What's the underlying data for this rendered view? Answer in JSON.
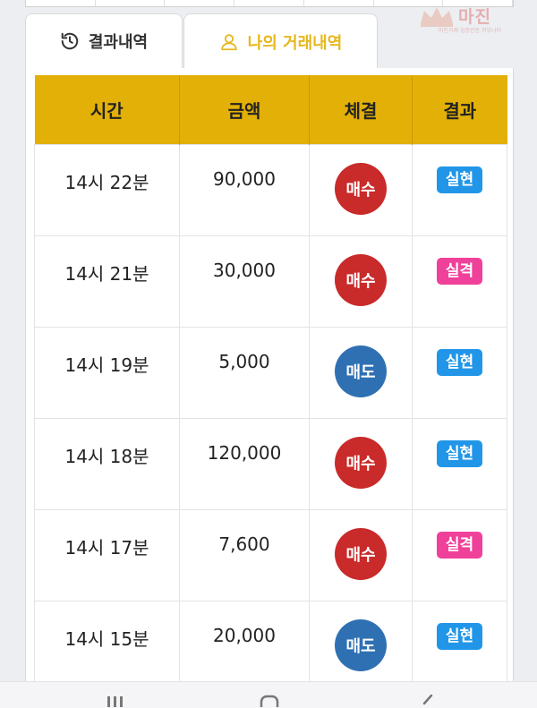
{
  "logo": {
    "text": "마진",
    "subtext": "마진거래 검증전문 커뮤니티"
  },
  "tabs": [
    {
      "label": "결과내역",
      "icon": "history-icon",
      "active": false
    },
    {
      "label": "나의 거래내역",
      "icon": "user-icon",
      "active": true
    }
  ],
  "table": {
    "headers": [
      "시간",
      "금액",
      "체결",
      "결과"
    ],
    "rows": [
      {
        "time": "14시 22분",
        "amount": "90,000",
        "trade": "매수",
        "trade_type": "buy",
        "result": "실현",
        "result_type": "win"
      },
      {
        "time": "14시 21분",
        "amount": "30,000",
        "trade": "매수",
        "trade_type": "buy",
        "result": "실격",
        "result_type": "lose"
      },
      {
        "time": "14시 19분",
        "amount": "5,000",
        "trade": "매도",
        "trade_type": "sell",
        "result": "실현",
        "result_type": "win"
      },
      {
        "time": "14시 18분",
        "amount": "120,000",
        "trade": "매수",
        "trade_type": "buy",
        "result": "실현",
        "result_type": "win"
      },
      {
        "time": "14시 17분",
        "amount": "7,600",
        "trade": "매수",
        "trade_type": "buy",
        "result": "실격",
        "result_type": "lose"
      },
      {
        "time": "14시 15분",
        "amount": "20,000",
        "trade": "매도",
        "trade_type": "sell",
        "result": "실현",
        "result_type": "win"
      }
    ]
  },
  "colors": {
    "accent": "#e2b007",
    "active_tab": "#e7b71c",
    "buy": "#c92a2a",
    "sell": "#2f70b3",
    "win": "#2196e8",
    "lose": "#f0419a"
  },
  "bottom_nav": [
    "recent-apps-icon",
    "home-icon",
    "back-icon"
  ]
}
